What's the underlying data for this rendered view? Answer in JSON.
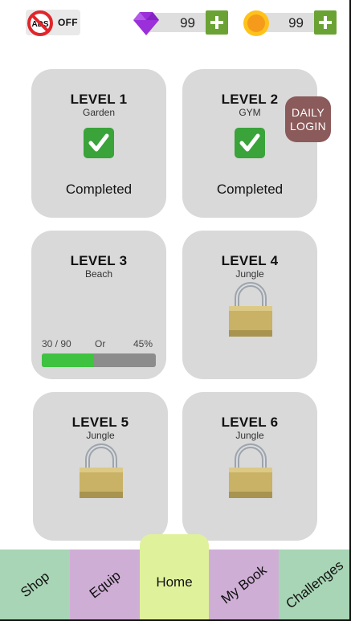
{
  "topbar": {
    "ads_label": "OFF",
    "gems": {
      "value": "99",
      "icon": "gem-icon",
      "color": "#9b2fd9"
    },
    "coins": {
      "value": "99",
      "icon": "coin-icon",
      "color": "#f5a623"
    }
  },
  "levels": [
    {
      "title": "LEVEL 1",
      "subtitle": "Garden",
      "status": "Completed"
    },
    {
      "title": "LEVEL 2",
      "subtitle": "GYM",
      "status": "Completed"
    },
    {
      "title": "LEVEL 3",
      "subtitle": "Beach",
      "progress_text": "30 / 90",
      "or_text": "Or",
      "percent_text": "45%",
      "progress": 0.45
    },
    {
      "title": "LEVEL 4",
      "subtitle": "Jungle",
      "locked": true
    },
    {
      "title": "LEVEL 5",
      "subtitle": "Jungle",
      "locked": true
    },
    {
      "title": "LEVEL 6",
      "subtitle": "Jungle",
      "locked": true
    }
  ],
  "daily_login": {
    "line1": "DAILY",
    "line2": "LOGIN"
  },
  "nav": {
    "shop": "Shop",
    "equip": "Equip",
    "home": "Home",
    "mybook": "My Book",
    "challenges": "Challenges"
  },
  "colors": {
    "accent_green": "#6aa234",
    "progress_green": "#3fc23f",
    "card_bg": "#d9d9d9",
    "daily_bg": "#8b5a5a",
    "nav_green": "#a8d5b5",
    "nav_purple": "#cfaed6",
    "nav_home": "#e0f19c"
  }
}
